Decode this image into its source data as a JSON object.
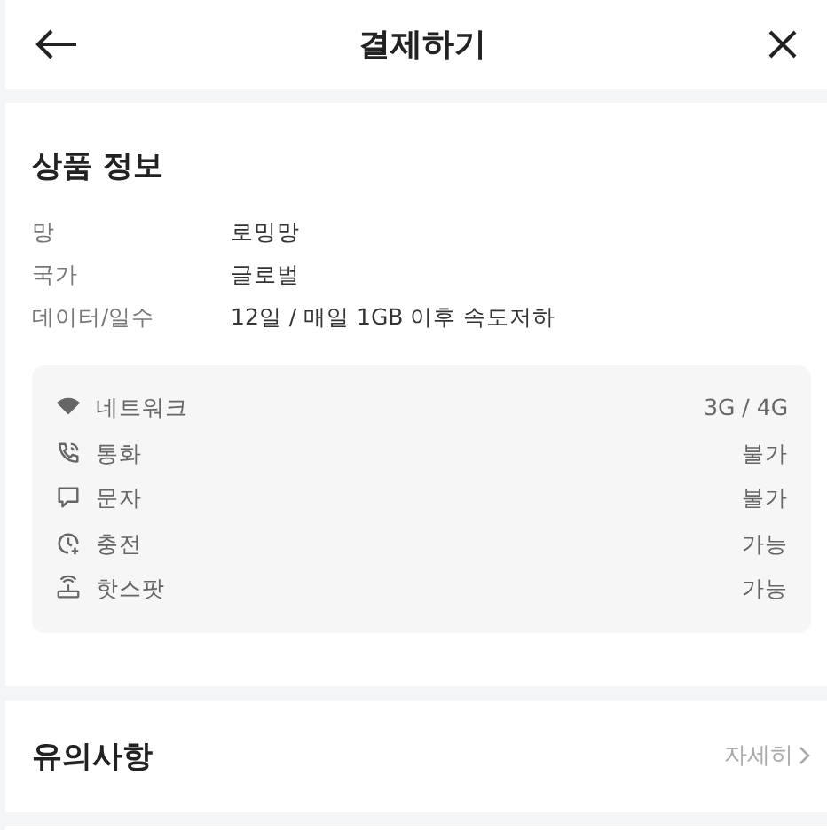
{
  "header": {
    "title": "결제하기"
  },
  "product": {
    "title": "상품 정보",
    "rows": [
      {
        "label": "망",
        "value": "로밍망"
      },
      {
        "label": "국가",
        "value": "글로벌"
      },
      {
        "label": "데이터/일수",
        "value": "12일 / 매일 1GB 이후 속도저하"
      }
    ],
    "features": [
      {
        "label": "네트워크",
        "value": "3G / 4G"
      },
      {
        "label": "통화",
        "value": "불가"
      },
      {
        "label": "문자",
        "value": "불가"
      },
      {
        "label": "충전",
        "value": "가능"
      },
      {
        "label": "핫스팟",
        "value": "가능"
      }
    ]
  },
  "notice": {
    "title": "유의사항",
    "link": "자세히"
  }
}
